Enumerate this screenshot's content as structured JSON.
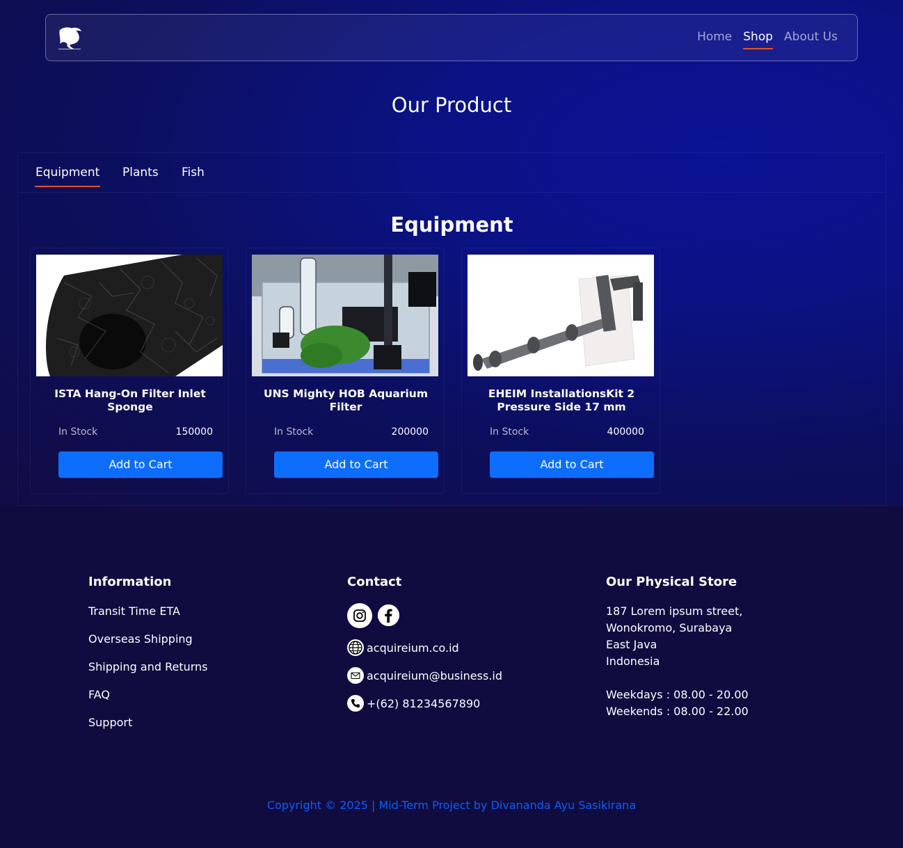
{
  "nav": {
    "logo_icon": "betta-fish-logo",
    "links": [
      {
        "label": "Home",
        "active": false
      },
      {
        "label": "Shop",
        "active": true
      },
      {
        "label": "About Us",
        "active": false
      }
    ]
  },
  "page_title": "Our Product",
  "tabs": [
    {
      "label": "Equipment",
      "active": true
    },
    {
      "label": "Plants",
      "active": false
    },
    {
      "label": "Fish",
      "active": false
    }
  ],
  "section_title": "Equipment",
  "products": [
    {
      "name": "ISTA Hang-On Filter Inlet Sponge",
      "stock": "In Stock",
      "price": "150000",
      "button": "Add to Cart",
      "image": "black-filter-sponge"
    },
    {
      "name": "UNS Mighty HOB Aquarium Filter",
      "stock": "In Stock",
      "price": "200000",
      "button": "Add to Cart",
      "image": "aquarium-tank-with-filters"
    },
    {
      "name": "EHEIM InstallationsKit 2 Pressure Side 17 mm",
      "stock": "In Stock",
      "price": "400000",
      "button": "Add to Cart",
      "image": "grey-pipe-installation-kit"
    }
  ],
  "footer": {
    "information": {
      "title": "Information",
      "links": [
        "Transit Time ETA",
        "Overseas Shipping",
        "Shipping and Returns",
        "FAQ",
        "Support"
      ]
    },
    "contact": {
      "title": "Contact",
      "social": [
        "instagram-icon",
        "facebook-icon"
      ],
      "website": "acquireium.co.id",
      "email": "acquireium@business.id",
      "phone": "+(62) 81234567890"
    },
    "store": {
      "title": "Our Physical Store",
      "address": [
        "187 Lorem ipsum street,",
        "Wonokromo, Surabaya",
        "East Java",
        "Indonesia"
      ],
      "hours": [
        "Weekdays : 08.00 - 20.00",
        "Weekends : 08.00 - 22.00"
      ]
    },
    "copyright": "Copyright © 2025 | Mid-Term Project by Divananda Ayu Sasikirana"
  },
  "colors": {
    "accent": "#e5551f",
    "button": "#0d6efd",
    "copyright": "#0d5ff6",
    "footer_bg": "#100c40"
  }
}
